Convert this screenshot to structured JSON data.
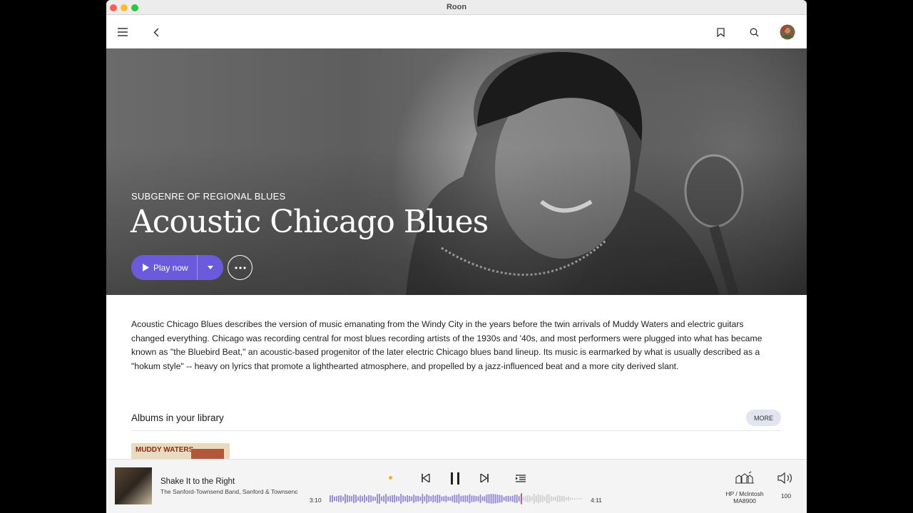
{
  "window": {
    "title": "Roon"
  },
  "topbar": {
    "icons": [
      "menu-icon",
      "back-icon",
      "bookmark-icon",
      "search-icon",
      "avatar"
    ]
  },
  "hero": {
    "subgenre": "SUBGENRE OF REGIONAL BLUES",
    "title": "Acoustic Chicago Blues",
    "play_label": "Play now"
  },
  "description": "Acoustic Chicago Blues describes the version of music emanating from the Windy City in the years before the twin arrivals of Muddy Waters and electric guitars changed everything. Chicago was recording central for most blues recording artists of the 1930s and '40s, and most performers were plugged into what has became known as \"the Bluebird Beat,\" an acoustic-based progenitor of the later electric Chicago blues band lineup. Its music is earmarked by what is usually described as a \"hokum style\" -- heavy on lyrics that promote a lighthearted atmosphere, and propelled by a jazz-influenced beat and a more city derived slant.",
  "albums": {
    "title": "Albums in your library",
    "more_label": "MORE",
    "items": [
      {
        "cover_text": "MUDDY WATERS"
      }
    ]
  },
  "player": {
    "track": "Shake It to the Right",
    "artist": "The Sanford-Townsend Band, Sanford & Townsend",
    "elapsed": "3:10",
    "duration": "4:11",
    "progress": 0.757,
    "zone_line1": "HP / McIntosh",
    "zone_line2": "MA8900",
    "volume": "100",
    "accent": "#6b5bdc"
  }
}
